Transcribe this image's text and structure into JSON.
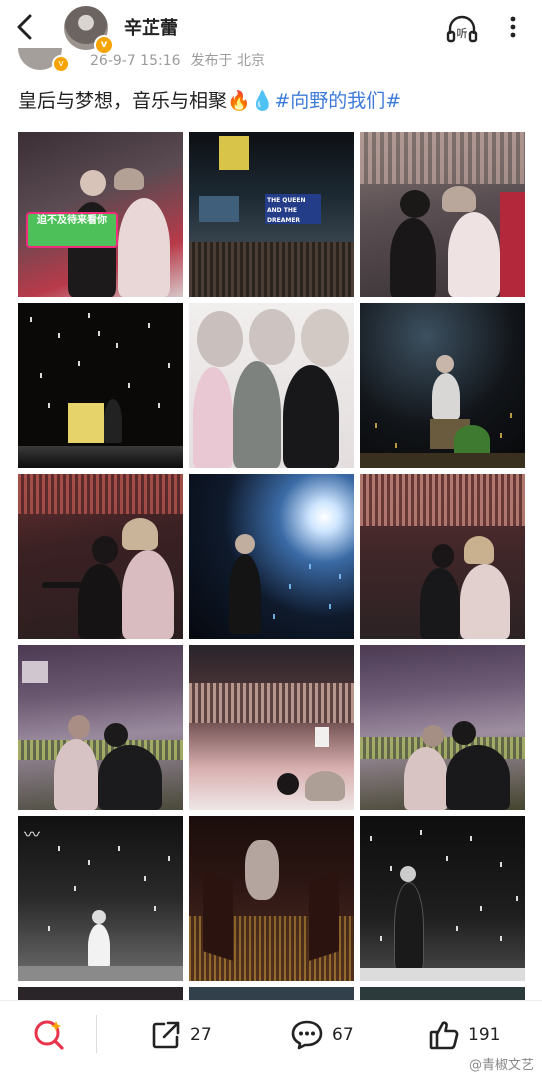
{
  "header": {
    "username": "辛芷蕾",
    "listen_label": "听"
  },
  "post": {
    "date": "26-9-7 15:16",
    "location": "发布于 北京",
    "text_main": "皇后与梦想，音乐与相聚",
    "emoji_fire": "🔥",
    "emoji_drop": "💧",
    "topic": "#向野的我们#"
  },
  "photos": [
    {
      "scene": "fans-holding-sign",
      "sign_text": "迫不及待来看你"
    },
    {
      "scene": "stage-big-screen",
      "screen_text": "THE QUEEN AND THE DREAMER"
    },
    {
      "scene": "two-women-seated"
    },
    {
      "scene": "piano-on-stage"
    },
    {
      "scene": "group-portrait"
    },
    {
      "scene": "guitarist-on-stool"
    },
    {
      "scene": "audience-pointing"
    },
    {
      "scene": "singer-in-spotlight"
    },
    {
      "scene": "two-women-in-stands"
    },
    {
      "scene": "hugging-in-arena"
    },
    {
      "scene": "arena-balcony"
    },
    {
      "scene": "hugging-close-up"
    },
    {
      "scene": "bw-stage-with-calligraphy"
    },
    {
      "scene": "screen-and-stage"
    },
    {
      "scene": "bw-performer-confetti"
    }
  ],
  "actions": {
    "repost_count": "27",
    "comment_count": "67",
    "like_count": "191"
  },
  "watermark": "@青椒文艺",
  "colors": {
    "accent_orange": "#f7a300",
    "topic_blue": "#3d7bd8",
    "search_red": "#e8334a"
  }
}
